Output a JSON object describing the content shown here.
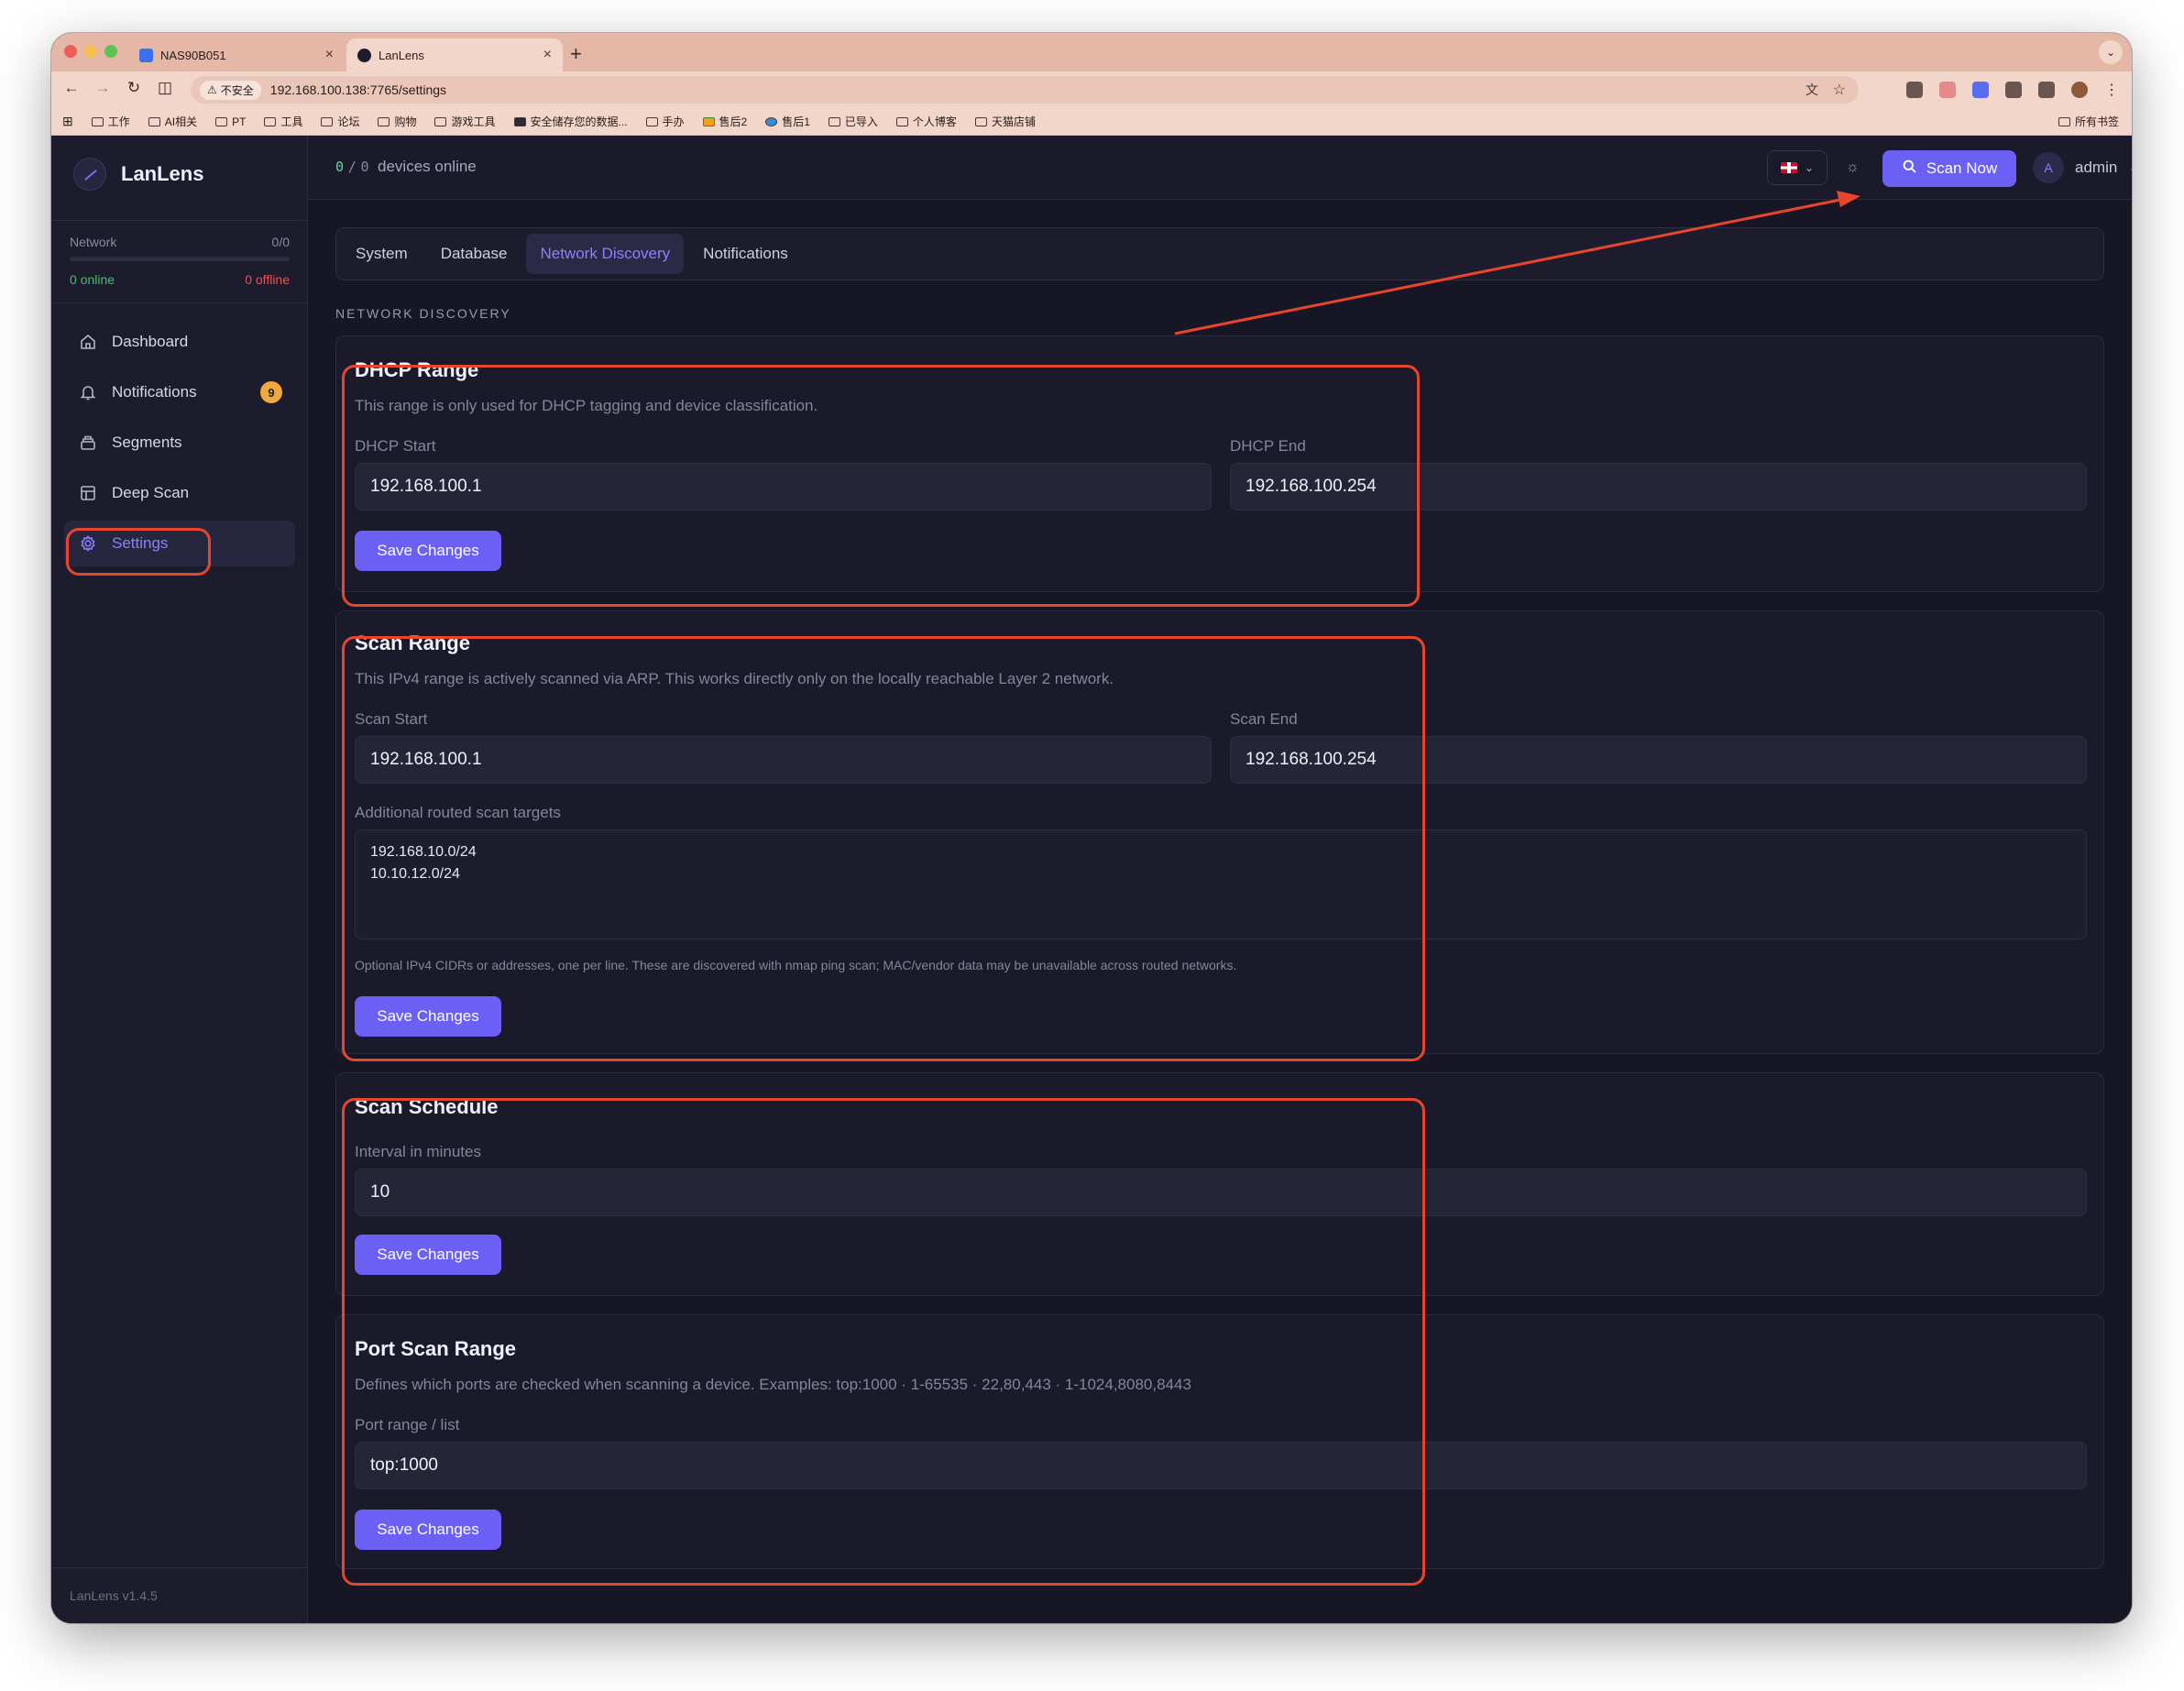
{
  "browser": {
    "tabs": [
      {
        "title": "NAS90B051"
      },
      {
        "title": "LanLens"
      }
    ],
    "new_tab": "+",
    "insecure_label": "不安全",
    "url": "192.168.100.138:7765/settings",
    "bookmarks": [
      "工作",
      "AI相关",
      "PT",
      "工具",
      "论坛",
      "购物",
      "游戏工具",
      "安全储存您的数据...",
      "手办",
      "售后2",
      "售后1",
      "已导入",
      "个人博客",
      "天猫店铺"
    ],
    "bookmarks_right": "所有书签"
  },
  "app": {
    "name": "LanLens",
    "network": {
      "label": "Network",
      "count": "0/0",
      "online": "0 online",
      "offline": "0 offline"
    },
    "nav": [
      {
        "label": "Dashboard",
        "icon": "home-icon"
      },
      {
        "label": "Notifications",
        "icon": "bell-icon",
        "badge": "9"
      },
      {
        "label": "Segments",
        "icon": "layers-icon"
      },
      {
        "label": "Deep Scan",
        "icon": "grid-icon"
      },
      {
        "label": "Settings",
        "icon": "gear-icon",
        "active": true
      }
    ],
    "version": "LanLens v1.4.5"
  },
  "header": {
    "devices_online": "0",
    "devices_total": "0",
    "devices_sep": "/",
    "devices_label": "devices online",
    "scan_button": "Scan Now",
    "user": "admin",
    "avatar_initial": "A"
  },
  "settings": {
    "tabs": [
      "System",
      "Database",
      "Network Discovery",
      "Notifications"
    ],
    "active_tab": "Network Discovery",
    "section_title": "NETWORK DISCOVERY",
    "dhcp": {
      "title": "DHCP Range",
      "description": "This range is only used for DHCP tagging and device classification.",
      "start_label": "DHCP Start",
      "start_value": "192.168.100.1",
      "end_label": "DHCP End",
      "end_value": "192.168.100.254",
      "save": "Save Changes"
    },
    "scan_range": {
      "title": "Scan Range",
      "description": "This IPv4 range is actively scanned via ARP. This works directly only on the locally reachable Layer 2 network.",
      "start_label": "Scan Start",
      "start_value": "192.168.100.1",
      "end_label": "Scan End",
      "end_value": "192.168.100.254",
      "targets_label": "Additional routed scan targets",
      "targets_value": "192.168.10.0/24\n10.10.12.0/24",
      "hint": "Optional IPv4 CIDRs or addresses, one per line. These are discovered with nmap ping scan; MAC/vendor data may be unavailable across routed networks.",
      "save": "Save Changes"
    },
    "schedule": {
      "title": "Scan Schedule",
      "interval_label": "Interval in minutes",
      "interval_value": "10",
      "save": "Save Changes"
    },
    "ports": {
      "title": "Port Scan Range",
      "description": "Defines which ports are checked when scanning a device. Examples: top:1000 · 1-65535 · 22,80,443 · 1-1024,8080,8443",
      "range_label": "Port range / list",
      "range_value": "top:1000",
      "save": "Save Changes"
    }
  },
  "colors": {
    "accent": "#6c5ff5",
    "annotation": "#e8452c",
    "online": "#3fc46b",
    "offline": "#ef4f4f",
    "badge": "#f0a93a"
  }
}
